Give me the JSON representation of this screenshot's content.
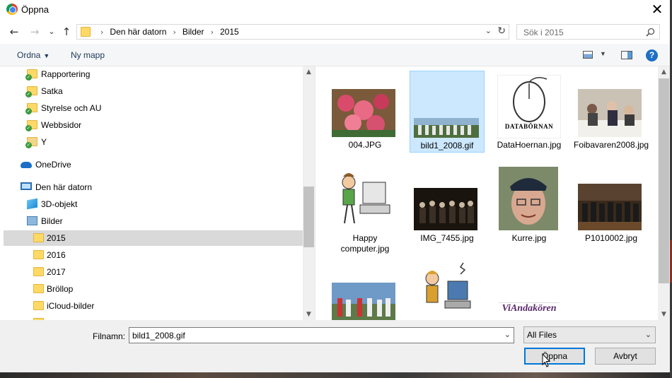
{
  "window": {
    "title": "Öppna",
    "close_glyph": "✕"
  },
  "nav": {
    "back_glyph": "←",
    "forward_glyph": "→",
    "recent_glyph": "⌄",
    "up_glyph": "↑"
  },
  "address": {
    "crumbs": [
      "Den här datorn",
      "Bilder",
      "2015"
    ],
    "separator": "›",
    "dropdown_glyph": "⌄",
    "refresh_glyph": "↻"
  },
  "search": {
    "placeholder": "Sök i 2015",
    "icon": "search-icon"
  },
  "toolbar": {
    "organize_label": "Ordna",
    "organize_arrow": "▼",
    "new_folder_label": "Ny mapp",
    "view_arrow": "▼",
    "help_glyph": "?"
  },
  "sidebar": {
    "items": [
      {
        "label": "Rapportering",
        "icon": "folder-sync-icon"
      },
      {
        "label": "Satka",
        "icon": "folder-sync-icon"
      },
      {
        "label": "Styrelse och AU",
        "icon": "folder-sync-icon"
      },
      {
        "label": "Webbsidor",
        "icon": "folder-sync-icon"
      },
      {
        "label": "Y",
        "icon": "shared-folder-icon"
      },
      {
        "label": "OneDrive",
        "icon": "onedrive-icon"
      },
      {
        "label": "Den här datorn",
        "icon": "computer-icon"
      },
      {
        "label": "3D-objekt",
        "icon": "3d-objects-icon"
      },
      {
        "label": "Bilder",
        "icon": "pictures-icon"
      },
      {
        "label": "2015",
        "icon": "folder-icon",
        "selected": true
      },
      {
        "label": "2016",
        "icon": "folder-icon"
      },
      {
        "label": "2017",
        "icon": "folder-icon"
      },
      {
        "label": "Bröllop",
        "icon": "folder-icon"
      },
      {
        "label": "iCloud-bilder",
        "icon": "folder-icon"
      }
    ],
    "scroll_up": "▲",
    "scroll_down": "▼"
  },
  "files": [
    {
      "name": "004.JPG"
    },
    {
      "name": "bild1_2008.gif",
      "selected": true
    },
    {
      "name": "DataHoernan.jpg",
      "thumb_text": "DATABÖRNAN"
    },
    {
      "name": "Foibavaren2008.jpg"
    },
    {
      "name": "Happy computer.jpg"
    },
    {
      "name": "IMG_7455.jpg"
    },
    {
      "name": "Kurre.jpg"
    },
    {
      "name": "P1010002.jpg"
    },
    {
      "name": ""
    },
    {
      "name": ""
    },
    {
      "name": "",
      "thumb_text": "ViAndakören"
    }
  ],
  "bottom": {
    "filename_label": "Filnamn:",
    "filename_value": "bild1_2008.gif",
    "filter_value": "All Files",
    "dropdown_glyph": "⌄",
    "open_label": "Öppna",
    "cancel_label": "Avbryt"
  }
}
